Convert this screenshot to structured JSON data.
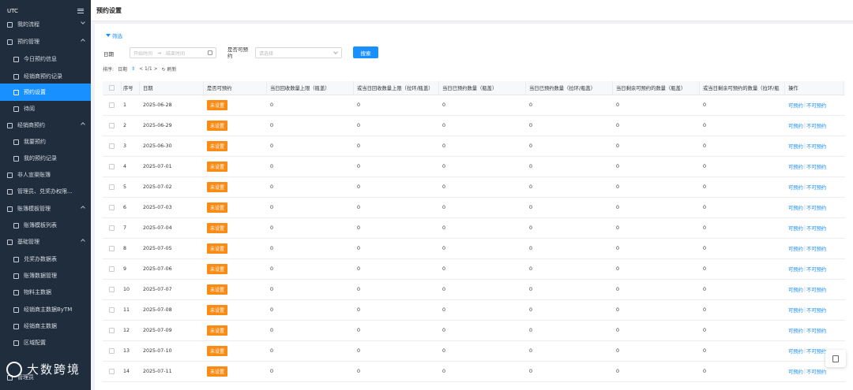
{
  "sidebar": {
    "brand": "UTC",
    "items": [
      {
        "label": "我的流程",
        "level": 1,
        "chevron": "down"
      },
      {
        "label": "预约管理",
        "level": 1,
        "chevron": "up"
      },
      {
        "label": "今日预约信息",
        "level": 2
      },
      {
        "label": "经销商预约记录",
        "level": 2
      },
      {
        "label": "预约设置",
        "level": 2,
        "active": true
      },
      {
        "label": "待阅",
        "level": 2
      },
      {
        "label": "经销商预约",
        "level": 1,
        "chevron": "up"
      },
      {
        "label": "我要预约",
        "level": 2
      },
      {
        "label": "我的预约记录",
        "level": 2
      },
      {
        "label": "非人宣渠账簿",
        "level": 1
      },
      {
        "label": "管理员、兑奖办权限...",
        "level": 1
      },
      {
        "label": "账簿模板管理",
        "level": 1,
        "chevron": "up"
      },
      {
        "label": "账簿模板列表",
        "level": 2
      },
      {
        "label": "基础管理",
        "level": 1,
        "chevron": "up"
      },
      {
        "label": "兑奖办数据表",
        "level": 2
      },
      {
        "label": "账簿数据管理",
        "level": 2
      },
      {
        "label": "物料主数据",
        "level": 2
      },
      {
        "label": "经销商主数据ByTM",
        "level": 2
      },
      {
        "label": "经销商主数据",
        "level": 2
      },
      {
        "label": "区域配置",
        "level": 2
      },
      {
        "label": "管理员",
        "level": 1
      }
    ],
    "watermark": "大数跨境"
  },
  "header": {
    "title": "预约设置"
  },
  "filters": {
    "toggle_label": "筛选",
    "date_label": "日期",
    "date_start_placeholder": "开始时间",
    "date_arrow": "→",
    "date_end_placeholder": "结束时间",
    "bookable_label": "是否可预约",
    "bookable_placeholder": "请选择",
    "search_button": "搜索"
  },
  "sortbar": {
    "sort_label": "排序:",
    "sort_field": "日期",
    "sort_icon": "⇕",
    "pagination": "< 1/1 >",
    "refresh": "↻ 刷新"
  },
  "table": {
    "columns": [
      "序号",
      "日期",
      "是否可预约",
      "当日回收数量上限（瓶盖）",
      "或当日回收数量上限（拉环/瓶盖）",
      "当日已预约数量（瓶盖）",
      "当日已预约数量（拉环/瓶盖）",
      "当日剩余可预约的数量（瓶盖）",
      "或当日剩余可预约的数量（拉环/瓶",
      "操作"
    ],
    "status_label": "未设置",
    "op_bookable": "可预约",
    "op_separator": "|",
    "op_not_bookable": "不可预约",
    "rows": [
      {
        "no": "1",
        "date": "2025-06-28",
        "a": "0",
        "b": "0",
        "c": "0",
        "d": "0",
        "e": "0",
        "f": "0"
      },
      {
        "no": "2",
        "date": "2025-06-29",
        "a": "0",
        "b": "0",
        "c": "0",
        "d": "0",
        "e": "0",
        "f": "0"
      },
      {
        "no": "3",
        "date": "2025-06-30",
        "a": "0",
        "b": "0",
        "c": "0",
        "d": "0",
        "e": "0",
        "f": "0"
      },
      {
        "no": "4",
        "date": "2025-07-01",
        "a": "0",
        "b": "0",
        "c": "0",
        "d": "0",
        "e": "0",
        "f": "0"
      },
      {
        "no": "5",
        "date": "2025-07-02",
        "a": "0",
        "b": "0",
        "c": "0",
        "d": "0",
        "e": "0",
        "f": "0"
      },
      {
        "no": "6",
        "date": "2025-07-03",
        "a": "0",
        "b": "0",
        "c": "0",
        "d": "0",
        "e": "0",
        "f": "0"
      },
      {
        "no": "7",
        "date": "2025-07-04",
        "a": "0",
        "b": "0",
        "c": "0",
        "d": "0",
        "e": "0",
        "f": "0"
      },
      {
        "no": "8",
        "date": "2025-07-05",
        "a": "0",
        "b": "0",
        "c": "0",
        "d": "0",
        "e": "0",
        "f": "0"
      },
      {
        "no": "9",
        "date": "2025-07-06",
        "a": "0",
        "b": "0",
        "c": "0",
        "d": "0",
        "e": "0",
        "f": "0"
      },
      {
        "no": "10",
        "date": "2025-07-07",
        "a": "0",
        "b": "0",
        "c": "0",
        "d": "0",
        "e": "0",
        "f": "0"
      },
      {
        "no": "11",
        "date": "2025-07-08",
        "a": "0",
        "b": "0",
        "c": "0",
        "d": "0",
        "e": "0",
        "f": "0"
      },
      {
        "no": "12",
        "date": "2025-07-09",
        "a": "0",
        "b": "0",
        "c": "0",
        "d": "0",
        "e": "0",
        "f": "0"
      },
      {
        "no": "13",
        "date": "2025-07-10",
        "a": "0",
        "b": "0",
        "c": "0",
        "d": "0",
        "e": "0",
        "f": "0"
      },
      {
        "no": "14",
        "date": "2025-07-11",
        "a": "0",
        "b": "0",
        "c": "0",
        "d": "0",
        "e": "0",
        "f": "0"
      }
    ]
  },
  "colors": {
    "accent": "#1890ff",
    "sidebar_bg": "#1f2d3d",
    "badge": "#fa8c16"
  }
}
